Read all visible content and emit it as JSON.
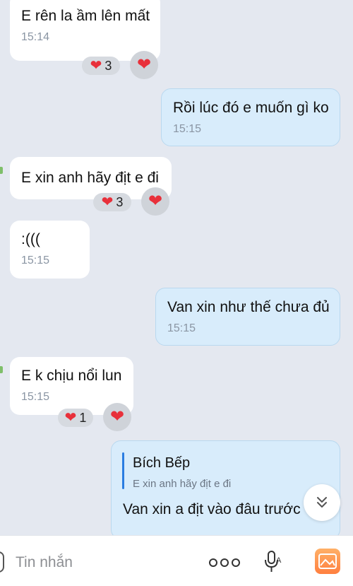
{
  "messages": [
    {
      "text": "E rên la ầm lên mất",
      "time": "15:14",
      "reaction_count": "3"
    },
    {
      "text": "Rồi lúc đó e muốn gì ko",
      "time": "15:15"
    },
    {
      "text": "E xin anh hãy địt e đi",
      "reaction_count": "3"
    },
    {
      "text": ":(((",
      "time": "15:15"
    },
    {
      "text": "Van xin như thế chưa đủ",
      "time": "15:15"
    },
    {
      "text": "E k chịu nổi lun",
      "time": "15:15",
      "reaction_count": "1"
    }
  ],
  "reply": {
    "quoted_name": "Bích Bếp",
    "quoted_text": "E xin anh hãy địt e đi",
    "text": "Van xin a địt vào đâu trước"
  },
  "input": {
    "placeholder": "Tin nhắn"
  },
  "icons": {
    "reaction": "heart-icon",
    "scroll": "chevron-double-down-icon",
    "more": "more-dots-icon",
    "voice": "microphone-icon",
    "gallery": "gallery-icon"
  },
  "colors": {
    "background": "#e4e8f0",
    "outgoing_bubble": "#d8ecfb",
    "incoming_bubble": "#ffffff",
    "heart": "#e8303a",
    "quote_bar": "#2b7de1"
  }
}
